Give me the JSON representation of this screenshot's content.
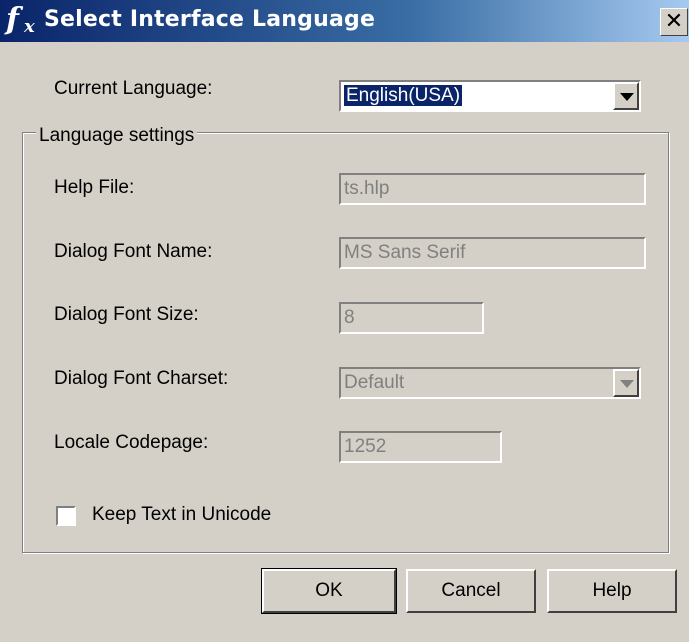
{
  "window": {
    "title": "Select Interface Language",
    "icon": "fx-icon",
    "close_label": "✕"
  },
  "current_language": {
    "label": "Current Language:",
    "value": "English(USA)"
  },
  "group": {
    "label": "Language settings"
  },
  "fields": {
    "help_file": {
      "label": "Help File:",
      "value": "ts.hlp"
    },
    "font_name": {
      "label": "Dialog Font Name:",
      "value": "MS Sans Serif"
    },
    "font_size": {
      "label": "Dialog Font Size:",
      "value": "8"
    },
    "font_charset": {
      "label": "Dialog Font Charset:",
      "value": "Default"
    },
    "codepage": {
      "label": "Locale Codepage:",
      "value": "1252"
    }
  },
  "keep_unicode": {
    "label": "Keep Text in Unicode",
    "checked": false
  },
  "buttons": {
    "ok": "OK",
    "cancel": "Cancel",
    "help": "Help"
  },
  "colors": {
    "dialog_bg": "#d4d0c8",
    "title_start": "#0a246a",
    "title_end": "#a6caf0",
    "selection": "#0a246a"
  }
}
